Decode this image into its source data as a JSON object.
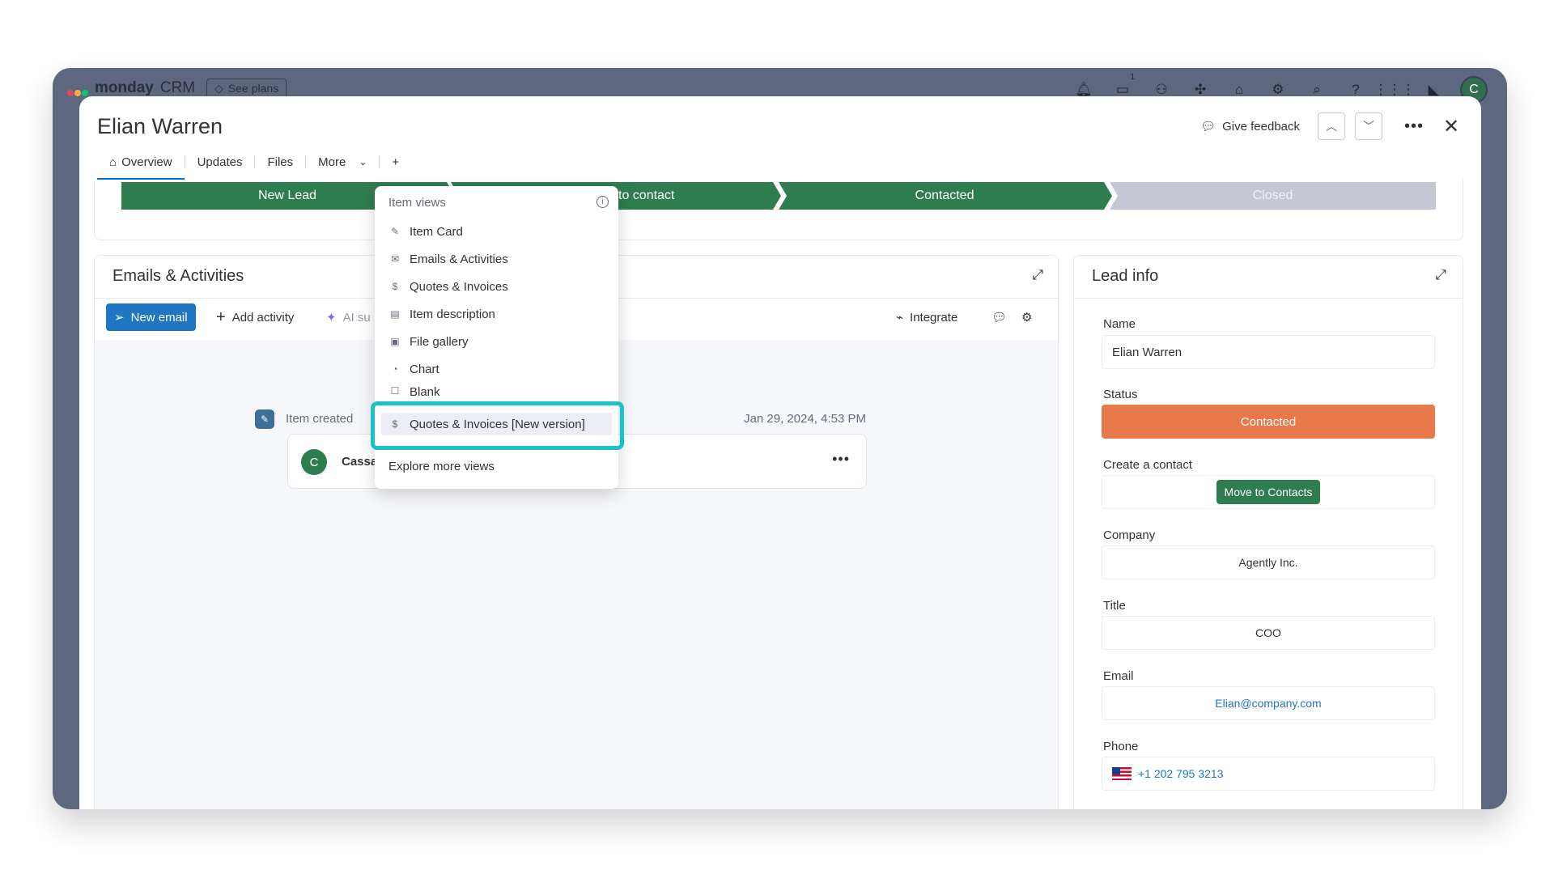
{
  "app": {
    "brand_bold": "monday",
    "brand_rest": "CRM",
    "see_plans": "See plans",
    "inbox_badge": "1",
    "user_initial": "C"
  },
  "item": {
    "title": "Elian Warren",
    "tabs": [
      "Overview",
      "Updates",
      "Files",
      "More"
    ],
    "add_tab": "+",
    "give_feedback": "Give feedback"
  },
  "pipeline": {
    "stages": [
      {
        "label": "New Lead",
        "state": "done"
      },
      {
        "label": "to contact",
        "state": "done"
      },
      {
        "label": "Contacted",
        "state": "done"
      },
      {
        "label": "Closed",
        "state": "pending"
      }
    ]
  },
  "emails_activities": {
    "title": "Emails & Activities",
    "new_email": "New email",
    "add_activity": "Add activity",
    "ai": "AI su",
    "integrate": "Integrate",
    "feed": {
      "label": "Item created",
      "date": "Jan 29, 2024, 4:53 PM",
      "author_initial": "C",
      "author": "Cassa"
    }
  },
  "dropdown": {
    "header": "Item views",
    "items": [
      {
        "label": "Item Card",
        "icon": "item-card-icon"
      },
      {
        "label": "Emails & Activities",
        "icon": "envelope-icon"
      },
      {
        "label": "Quotes & Invoices",
        "icon": "dollar-icon"
      },
      {
        "label": "Item description",
        "icon": "document-icon"
      },
      {
        "label": "File gallery",
        "icon": "image-icon"
      },
      {
        "label": "Chart",
        "icon": "chart-icon"
      },
      {
        "label": "Blank",
        "icon": "square-icon"
      }
    ],
    "highlighted": "Quotes & Invoices [New version]",
    "explore": "Explore more views"
  },
  "lead_info": {
    "title": "Lead info",
    "fields": {
      "name_label": "Name",
      "name_value": "Elian Warren",
      "status_label": "Status",
      "status_value": "Contacted",
      "create_contact_label": "Create a contact",
      "move_to_contacts": "Move to Contacts",
      "company_label": "Company",
      "company_value": "Agently Inc.",
      "title_label": "Title",
      "title_value": "COO",
      "email_label": "Email",
      "email_value": "Elian@company.com",
      "phone_label": "Phone",
      "phone_value": "+1 202 795 3213"
    }
  },
  "colors": {
    "stage_done": "#2f7d4f",
    "stage_pending": "#c5c7d4",
    "status_contacted": "#e8794a",
    "primary": "#1f76c2",
    "focus_ring": "#19c3c9"
  }
}
